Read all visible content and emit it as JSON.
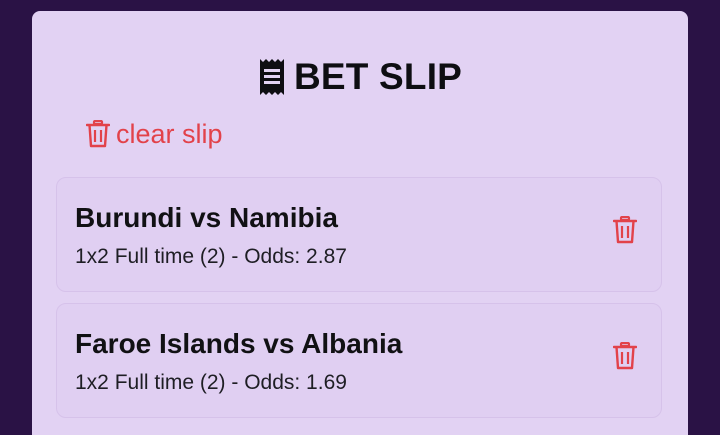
{
  "bet_slip": {
    "title": "BET SLIP",
    "clear_label": "clear slip",
    "accent_color": "#e2424a",
    "bets": [
      {
        "match": "Burundi vs Namibia",
        "market": "1x2 Full time",
        "selection": "(2)",
        "odds_label": "Odds:",
        "odds": "2.87",
        "detail": "1x2 Full time (2) - Odds: 2.87"
      },
      {
        "match": "Faroe Islands vs Albania",
        "market": "1x2 Full time",
        "selection": "(2)",
        "odds_label": "Odds:",
        "odds": "1.69",
        "detail": "1x2 Full time (2) - Odds: 1.69"
      }
    ]
  },
  "icons": {
    "title": "receipt-icon",
    "clear": "trash-icon",
    "delete": "trash-icon"
  }
}
